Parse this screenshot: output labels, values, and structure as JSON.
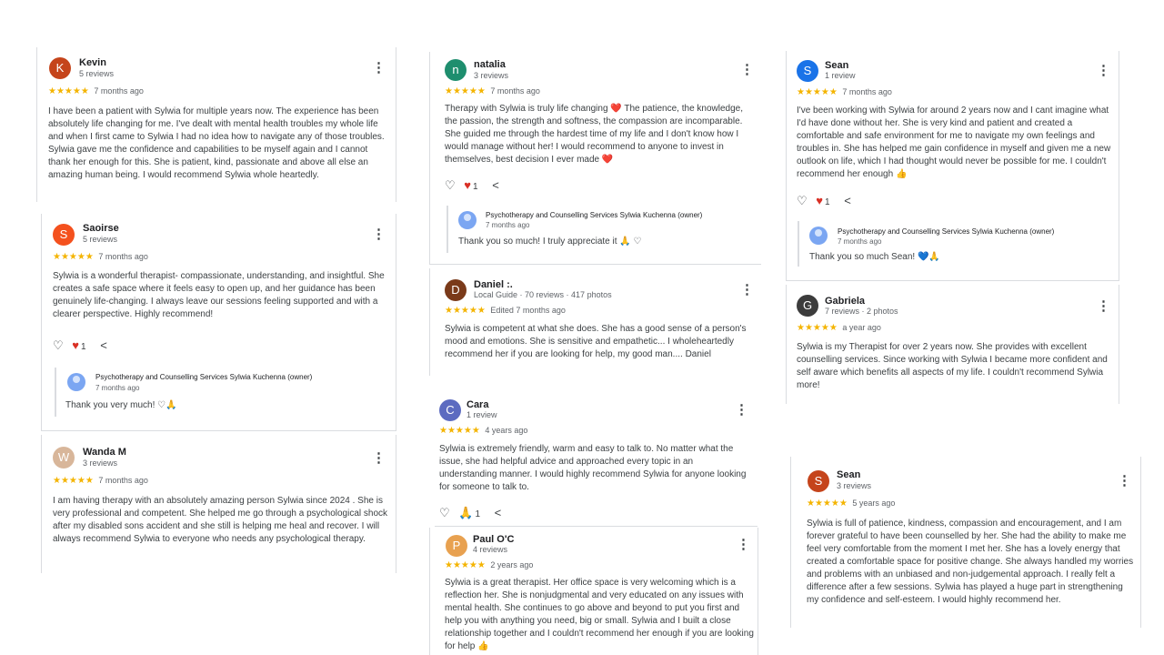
{
  "reviews": [
    {
      "name": "Kevin",
      "initial": "K",
      "avatar_color": "#c5441b",
      "meta": "5 reviews",
      "time": "7 months ago",
      "stars": "★★★★★",
      "text": "I have been a patient with Sylwia for multiple years now. The experience has been absolutely life changing for me. I've dealt with mental health troubles my whole life and when I first came to Sylwia I had no idea how to navigate any of those troubles. Sylwia gave me the confidence and capabilities to be myself again and I cannot thank her enough for this. She is patient, kind, passionate and above all else an amazing human being. I would recommend Sylwia whole heartedly."
    },
    {
      "name": "Saoirse",
      "initial": "S",
      "avatar_color": "#f4511e",
      "meta": "5 reviews",
      "time": "7 months ago",
      "stars": "★★★★★",
      "text": "Sylwia is a wonderful therapist- compassionate, understanding, and insightful. She creates a safe space where it feels easy to open up, and her guidance has been genuinely life-changing. I always leave our sessions feeling supported and with a clearer perspective. Highly recommend!",
      "like_count": "1",
      "owner_name": "Psychotherapy and Counselling Services Sylwia Kuchenna (owner)",
      "owner_time": "7 months ago",
      "owner_reply": "Thank you very much! ♡🙏"
    },
    {
      "name": "Wanda M",
      "initial": "W",
      "avatar_color": "#d8b69a",
      "meta": "3 reviews",
      "time": "7 months ago",
      "stars": "★★★★★",
      "text": "I am having therapy with an absolutely amazing person Sylwia since 2024 . She is very professional and competent. She helped me go through a psychological shock after my disabled sons accident and she still is helping me heal and recover. I will always recommend Sylwia to everyone who needs any psychological therapy."
    },
    {
      "name": "natalia",
      "initial": "n",
      "avatar_color": "#1e8e6e",
      "meta": "3 reviews",
      "time": "7 months ago",
      "stars": "★★★★★",
      "text": "Therapy with Sylwia is truly life changing ❤️ The patience, the knowledge, the passion, the strength and softness, the compassion are incomparable. She guided me through the hardest time of my life and I don't know how I would manage without her! I would recommend to anyone to invest in themselves, best decision I ever made ❤️",
      "like_count": "1",
      "owner_name": "Psychotherapy and Counselling Services Sylwia Kuchenna (owner)",
      "owner_time": "7 months ago",
      "owner_reply": "Thank you so much! I truly appreciate it 🙏 ♡"
    },
    {
      "name": "Daniel :.",
      "initial": "D",
      "avatar_color": "#7a3a1a",
      "meta": "Local Guide · 70 reviews · 417 photos",
      "time": "Edited 7 months ago",
      "stars": "★★★★★",
      "text": "Sylwia is competent at what she does. She has a good sense of a person's mood and emotions. She is sensitive and empathetic... I wholeheartedly recommend her if you are looking for help, my good man.... Daniel"
    },
    {
      "name": "Cara",
      "initial": "C",
      "avatar_color": "#5c6bc0",
      "meta": "1 review",
      "time": "4 years ago",
      "stars": "★★★★★",
      "text": "Sylwia is extremely friendly, warm and easy to talk to. No matter what the issue, she had helpful advice and approached every topic in an understanding manner. I would highly recommend Sylwia for anyone looking for someone to talk to.",
      "like_count": "1"
    },
    {
      "name": "Paul O'C",
      "initial": "P",
      "avatar_color": "#e8a150",
      "meta": "4 reviews",
      "time": "2 years ago",
      "stars": "★★★★★",
      "text": "Sylwia is a great therapist. Her office space is very welcoming which is a reflection her. She is nonjudgmental and very educated on any issues with mental health. She continues to go above and beyond to put you first and help you with anything you need, big or small. Sylwia and I built a close relationship together and I couldn't recommend her enough if you are looking for help 👍"
    },
    {
      "name": "Sean",
      "initial": "S",
      "avatar_color": "#1a73e8",
      "meta": "1 review",
      "time": "7 months ago",
      "stars": "★★★★★",
      "text": "I've been working with Sylwia for around 2 years now and I cant imagine what I'd have done without her. She is very kind and patient and created a comfortable and safe environment for me to navigate my own feelings and troubles in. She has helped me gain confidence in myself and given me a new outlook on life, which I had thought would never be possible for me. I couldn't recommend her enough 👍",
      "like_count": "1",
      "owner_name": "Psychotherapy and Counselling Services Sylwia Kuchenna (owner)",
      "owner_time": "7 months ago",
      "owner_reply": "Thank you so much Sean! 💙🙏"
    },
    {
      "name": "Gabriela",
      "initial": "G",
      "avatar_color": "#3c3c3c",
      "meta": "7 reviews · 2 photos",
      "time": "a year ago",
      "stars": "★★★★★",
      "text": "Sylwia is my Therapist for over 2 years now. She provides with excellent counselling services. Since working with Sylwia I became more confident and self aware which benefits all aspects of my life. I couldn't recommend Sylwia more!"
    },
    {
      "name": "Sean",
      "initial": "S",
      "avatar_color": "#c5441b",
      "meta": "3 reviews",
      "time": "5 years ago",
      "stars": "★★★★★",
      "text": "Sylwia is full of patience, kindness, compassion and encouragement, and I am forever grateful to have been counselled by her. She had the ability to make me feel very comfortable from the moment I met her. She has a lovely energy that created a comfortable space for positive change. She always handled my worries and problems with an unbiased and non-judgemental approach. I really felt a difference after a few sessions. Sylwia has played a huge part in strengthening my confidence and self-esteem. I would highly recommend her."
    }
  ]
}
